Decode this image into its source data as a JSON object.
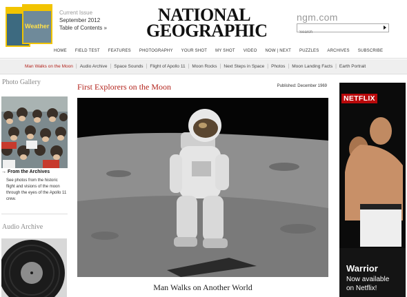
{
  "header": {
    "cover1_text": "",
    "cover2_text": "Weather",
    "current_issue_label": "Current Issue",
    "issue_month": "September 2012",
    "toc_link": "Table of Contents »",
    "logo_line1": "NATIONAL",
    "logo_line2": "GEOGRAPHIC",
    "site_link": "ngm.com",
    "search_placeholder": "Search"
  },
  "main_nav": [
    "HOME",
    "FIELD TEST",
    "FEATURES",
    "PHOTOGRAPHY",
    "YOUR SHOT",
    "MY SHOT",
    "VIDEO",
    "NOW | NEXT",
    "PUZZLES",
    "ARCHIVES",
    "SUBSCRIBE"
  ],
  "sub_nav": {
    "items": [
      "Man Walks on the Moon",
      "Audio Archive",
      "Space Sounds",
      "Flight of Apollo 11",
      "Moon Rocks",
      "Next Steps in Space",
      "Photos",
      "Moon Landing Facts",
      "Earth Portrait"
    ],
    "separator": "|"
  },
  "left": {
    "gallery_heading": "Photo Gallery",
    "archives_link": "From the Archives",
    "archives_arrow": "→",
    "archives_desc": "See photos from the historic flight and visions of the moon through the eyes of the Apollo 11 crew.",
    "audio_heading": "Audio Archive"
  },
  "article": {
    "title": "First Explorers on the Moon",
    "published": "Published: December 1969",
    "caption": "Man Walks on Another World"
  },
  "ad": {
    "brand": "NETFLIX",
    "title": "Warrior",
    "line1": "Now available",
    "line2": "on Netflix!"
  },
  "colors": {
    "accent_red": "#b3231c",
    "netflix_red": "#b9090b",
    "cover_yellow": "#f2c400"
  }
}
